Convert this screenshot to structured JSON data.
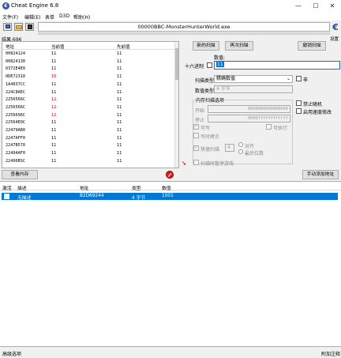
{
  "window": {
    "title": "Cheat Engine 6.8",
    "process_title": "00000BBC-MonsterHunterWorld.exe",
    "minimize": "—",
    "maximize": "☐",
    "close": "✕"
  },
  "menu": [
    "文件(F)",
    "编辑(E)",
    "表单",
    "D3D",
    "帮助(H)"
  ],
  "settings_label": "设置",
  "found_label": "结果:696",
  "results": {
    "columns": [
      "地址",
      "当前值",
      "先前值"
    ],
    "rows": [
      {
        "address": "00824124",
        "current": "11",
        "previous": "11",
        "changed": false
      },
      {
        "address": "00824130",
        "current": "11",
        "previous": "11",
        "changed": false
      },
      {
        "address": "0372E4E0",
        "current": "11",
        "previous": "11",
        "changed": false
      },
      {
        "address": "0DE72310",
        "current": "10",
        "previous": "11",
        "changed": true
      },
      {
        "address": "1A4837CC",
        "current": "11",
        "previous": "11",
        "changed": false
      },
      {
        "address": "224C8AEC",
        "current": "11",
        "previous": "11",
        "changed": false
      },
      {
        "address": "2256566C",
        "current": "12",
        "previous": "11",
        "changed": true
      },
      {
        "address": "2256566C",
        "current": "12",
        "previous": "11",
        "changed": true
      },
      {
        "address": "2256696C",
        "current": "12",
        "previous": "11",
        "changed": true
      },
      {
        "address": "22564E0C",
        "current": "11",
        "previous": "11",
        "changed": false
      },
      {
        "address": "22479AB0",
        "current": "11",
        "previous": "11",
        "changed": false
      },
      {
        "address": "2247AFF0",
        "current": "11",
        "previous": "11",
        "changed": false
      },
      {
        "address": "2247B570",
        "current": "11",
        "previous": "11",
        "changed": false
      },
      {
        "address": "22494AF0",
        "current": "11",
        "previous": "11",
        "changed": false
      },
      {
        "address": "22490BSC",
        "current": "11",
        "previous": "11",
        "changed": false
      }
    ]
  },
  "scan": {
    "new_scan": "新的扫描",
    "next_scan": "再次扫描",
    "undo_scan": "撤销扫描",
    "value_label": "数值:",
    "hex_label": "十六进制",
    "value_input": "11",
    "scan_type_label": "扫描类型",
    "scan_type_value": "精确数值",
    "not_label": "非",
    "value_type_label": "数值类型",
    "value_type_value": "4 字节",
    "memory_options_label": "内存扫描选项",
    "start_label": "开始",
    "start_value": "0000000000000000",
    "stop_label": "停止",
    "stop_value": "00007fffffffffff",
    "writable_label": "可写",
    "executable_label": "可执行",
    "copy_on_write_label": "写时拷贝",
    "fast_scan_label": "快速扫描",
    "fast_scan_value": "4",
    "alignment_label": "对齐",
    "last_digits_label": "最后位数",
    "pause_label": "扫描时暂停游戏",
    "disable_random_label": "禁止随机",
    "speedhack_label": "启用速度修改"
  },
  "memory_view_button": "查看内存",
  "add_address_button": "手动添加地址",
  "address_list": {
    "columns": [
      "激活",
      "描述",
      "地址",
      "类型",
      "数值"
    ],
    "rows": [
      {
        "description": "无描述",
        "address": "B2D69244",
        "type": "4 字节",
        "value": "1001"
      }
    ]
  },
  "status": {
    "left": "高级选项",
    "right": "附加注释"
  },
  "colors": {
    "changed_value": "#e00000",
    "selection": "#0078d7"
  }
}
